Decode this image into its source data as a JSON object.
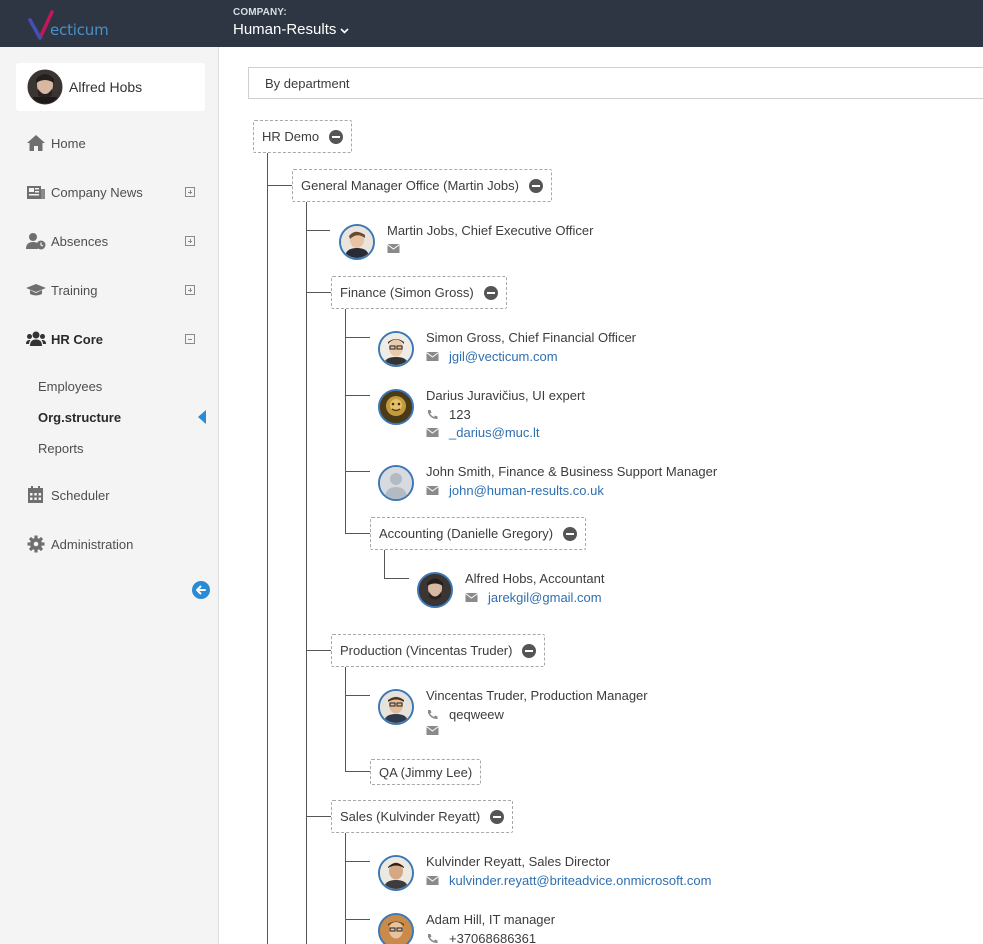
{
  "app": {
    "logo_text": "ecticum"
  },
  "header": {
    "company_label": "COMPANY:",
    "company_name": "Human-Results"
  },
  "user": {
    "name": "Alfred Hobs"
  },
  "sidebar": {
    "items": [
      {
        "label": "Home",
        "icon": "home-icon"
      },
      {
        "label": "Company News",
        "icon": "newspaper-icon",
        "expandable": true
      },
      {
        "label": "Absences",
        "icon": "user-clock-icon",
        "expandable": true
      },
      {
        "label": "Training",
        "icon": "graduation-cap-icon",
        "expandable": true
      },
      {
        "label": "HR Core",
        "icon": "users-icon",
        "expanded": true,
        "active": true
      },
      {
        "label": "Scheduler",
        "icon": "calendar-icon"
      },
      {
        "label": "Administration",
        "icon": "gear-icon"
      }
    ],
    "sub_items": [
      {
        "label": "Employees"
      },
      {
        "label": "Org.structure",
        "active": true
      },
      {
        "label": "Reports"
      }
    ]
  },
  "filter": {
    "value": "By department"
  },
  "tree": {
    "root": "HR Demo",
    "gm_office": "General Manager Office (Martin Jobs)",
    "finance": "Finance (Simon Gross)",
    "accounting": "Accounting (Danielle Gregory)",
    "production": "Production (Vincentas Truder)",
    "qa": "QA (Jimmy Lee)",
    "sales": "Sales (Kulvinder Reyatt)"
  },
  "people": {
    "martin": {
      "title": "Martin Jobs, Chief Executive Officer"
    },
    "simon": {
      "title": "Simon Gross, Chief Financial Officer",
      "email": "jgil@vecticum.com"
    },
    "darius": {
      "title": "Darius Juravičius, UI expert",
      "phone": "123",
      "email": "_darius@muc.lt"
    },
    "john": {
      "title": "John Smith, Finance & Business Support Manager",
      "email": "john@human-results.co.uk"
    },
    "alfred": {
      "title": "Alfred Hobs, Accountant",
      "email": "jarekgil@gmail.com"
    },
    "vincentas": {
      "title": "Vincentas Truder, Production Manager",
      "phone": "qeqweew"
    },
    "kulvinder": {
      "title": "Kulvinder Reyatt, Sales Director",
      "email": "kulvinder.reyatt@briteadvice.onmicrosoft.com"
    },
    "adam": {
      "title": "Adam Hill, IT manager",
      "phone": "+37068686361"
    }
  },
  "colors": {
    "topbar": "#2d3642",
    "accent": "#2a8ad3",
    "link": "#2f6fb0",
    "sidebar_bg": "#f4f4f4"
  }
}
